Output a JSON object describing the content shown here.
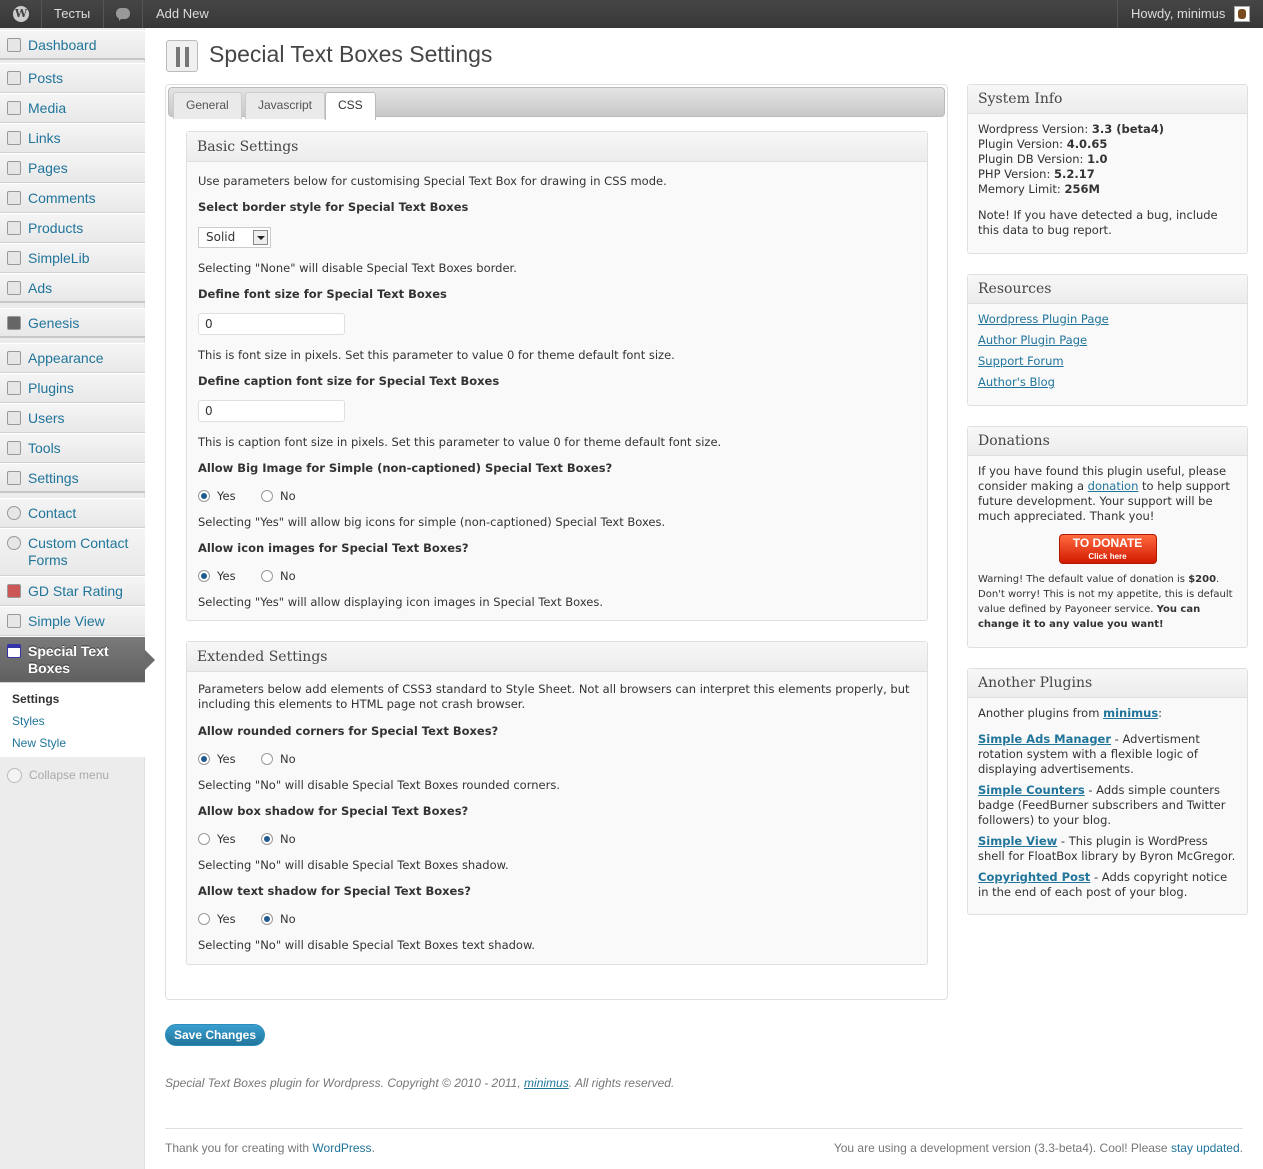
{
  "adminbar": {
    "site_name": "Тесты",
    "add_new": "Add New",
    "howdy": "Howdy, minimus"
  },
  "sidebar": {
    "items": [
      {
        "label": "Dashboard",
        "icon": "dashboard-icon"
      },
      {
        "label": "Posts",
        "icon": "pin-icon"
      },
      {
        "label": "Media",
        "icon": "media-icon"
      },
      {
        "label": "Links",
        "icon": "links-icon"
      },
      {
        "label": "Pages",
        "icon": "pages-icon"
      },
      {
        "label": "Comments",
        "icon": "comments-icon"
      },
      {
        "label": "Products",
        "icon": "pin-icon"
      },
      {
        "label": "SimpleLib",
        "icon": "pin-icon"
      },
      {
        "label": "Ads",
        "icon": "ads-icon"
      },
      {
        "label": "Genesis",
        "icon": "genesis-icon"
      },
      {
        "label": "Appearance",
        "icon": "appearance-icon"
      },
      {
        "label": "Plugins",
        "icon": "plugins-icon"
      },
      {
        "label": "Users",
        "icon": "users-icon"
      },
      {
        "label": "Tools",
        "icon": "tools-icon"
      },
      {
        "label": "Settings",
        "icon": "settings-icon"
      },
      {
        "label": "Contact",
        "icon": "contact-icon"
      },
      {
        "label": "Custom Contact Forms",
        "icon": "contact-icon"
      },
      {
        "label": "GD Star Rating",
        "icon": "star-icon"
      },
      {
        "label": "Simple View",
        "icon": "simpleview-icon"
      },
      {
        "label": "Special Text Boxes",
        "icon": "stb-icon"
      }
    ],
    "submenu": [
      "Settings",
      "Styles",
      "New Style"
    ],
    "collapse": "Collapse menu"
  },
  "page": {
    "title": "Special Text Boxes Settings",
    "tabs": [
      "General",
      "Javascript",
      "CSS"
    ],
    "active_tab": "CSS"
  },
  "basic": {
    "title": "Basic Settings",
    "intro": "Use parameters below for customising Special Text Box for drawing in CSS mode.",
    "border_label": "Select border style for Special Text Boxes",
    "border_value": "Solid",
    "border_note": "Selecting \"None\" will disable Special Text Boxes border.",
    "font_label": "Define font size for Special Text Boxes",
    "font_value": "0",
    "font_note": "This is font size in pixels. Set this parameter to value 0 for theme default font size.",
    "caption_label": "Define caption font size for Special Text Boxes",
    "caption_value": "0",
    "caption_note": "This is caption font size in pixels. Set this parameter to value 0 for theme default font size.",
    "bigimg_label": "Allow Big Image for Simple (non-captioned) Special Text Boxes?",
    "bigimg_note": "Selecting \"Yes\" will allow big icons for simple (non-captioned) Special Text Boxes.",
    "icon_label": "Allow icon images for Special Text Boxes?",
    "icon_note": "Selecting \"Yes\" will allow displaying icon images in Special Text Boxes.",
    "yes": "Yes",
    "no": "No"
  },
  "extended": {
    "title": "Extended Settings",
    "intro": "Parameters below add elements of CSS3 standard to Style Sheet. Not all browsers can interpret this elements properly, but including this elements to HTML page not crash browser.",
    "rounded_label": "Allow rounded corners for Special Text Boxes?",
    "rounded_note": "Selecting \"No\" will disable Special Text Boxes rounded corners.",
    "shadow_label": "Allow box shadow for Special Text Boxes?",
    "shadow_note": "Selecting \"No\" will disable Special Text Boxes shadow.",
    "tshadow_label": "Allow text shadow for Special Text Boxes?",
    "tshadow_note": "Selecting \"No\" will disable Special Text Boxes text shadow."
  },
  "save_label": "Save Changes",
  "copyright": {
    "prefix": "Special Text Boxes plugin for Wordpress. Copyright © 2010 - 2011,",
    "link": "minimus",
    "suffix": ". All rights reserved."
  },
  "footer": {
    "left_prefix": "Thank you for creating with",
    "left_link": "WordPress",
    "right_prefix": "You are using a development version (3.3-beta4). Cool! Please",
    "right_link": "stay updated"
  },
  "sysinfo": {
    "title": "System Info",
    "rows": [
      {
        "label": "Wordpress Version:",
        "value": "3.3 (beta4)"
      },
      {
        "label": "Plugin Version:",
        "value": "4.0.65"
      },
      {
        "label": "Plugin DB Version:",
        "value": "1.0"
      },
      {
        "label": "PHP Version:",
        "value": "5.2.17"
      },
      {
        "label": "Memory Limit:",
        "value": "256M"
      }
    ],
    "note": "Note! If you have detected a bug, include this data to bug report."
  },
  "resources": {
    "title": "Resources",
    "links": [
      "Wordpress Plugin Page",
      "Author Plugin Page",
      "Support Forum",
      "Author's Blog"
    ]
  },
  "donations": {
    "title": "Donations",
    "text_a": "If you have found this plugin useful, please consider making a",
    "text_link": "donation",
    "text_b": "to help support future development. Your support will be much appreciated. Thank you!",
    "btn_line1": "TO DONATE",
    "btn_line2": "Click here",
    "warn_a": "Warning! The default value of donation is",
    "warn_amount": "$200",
    "warn_b": ". Don't worry! This is not my appetite, this is default value defined by Payoneer service.",
    "warn_bold": "You can change it to any value you want!"
  },
  "another": {
    "title": "Another Plugins",
    "intro_prefix": "Another plugins from",
    "intro_link": "minimus",
    "plugins": [
      {
        "name": "Simple Ads Manager",
        "desc": " - Advertisment rotation system with a flexible logic of displaying advertisements."
      },
      {
        "name": "Simple Counters",
        "desc": " - Adds simple counters badge (FeedBurner subscribers and Twitter followers) to your blog."
      },
      {
        "name": "Simple View",
        "desc": " - This plugin is WordPress shell for FloatBox library by Byron McGregor."
      },
      {
        "name": "Copyrighted Post",
        "desc": " - Adds copyright notice in the end of each post of your blog."
      }
    ]
  }
}
